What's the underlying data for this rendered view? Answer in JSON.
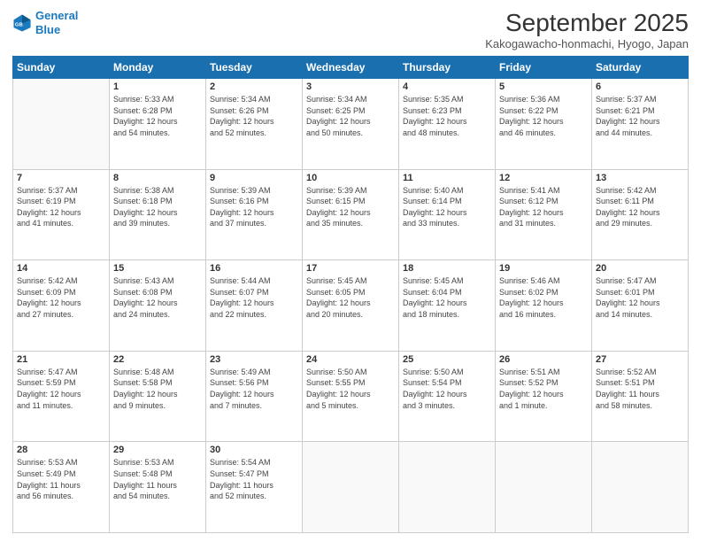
{
  "logo": {
    "line1": "General",
    "line2": "Blue"
  },
  "title": "September 2025",
  "location": "Kakogawacho-honmachi, Hyogo, Japan",
  "days_header": [
    "Sunday",
    "Monday",
    "Tuesday",
    "Wednesday",
    "Thursday",
    "Friday",
    "Saturday"
  ],
  "weeks": [
    [
      {
        "day": "",
        "info": ""
      },
      {
        "day": "1",
        "info": "Sunrise: 5:33 AM\nSunset: 6:28 PM\nDaylight: 12 hours\nand 54 minutes."
      },
      {
        "day": "2",
        "info": "Sunrise: 5:34 AM\nSunset: 6:26 PM\nDaylight: 12 hours\nand 52 minutes."
      },
      {
        "day": "3",
        "info": "Sunrise: 5:34 AM\nSunset: 6:25 PM\nDaylight: 12 hours\nand 50 minutes."
      },
      {
        "day": "4",
        "info": "Sunrise: 5:35 AM\nSunset: 6:23 PM\nDaylight: 12 hours\nand 48 minutes."
      },
      {
        "day": "5",
        "info": "Sunrise: 5:36 AM\nSunset: 6:22 PM\nDaylight: 12 hours\nand 46 minutes."
      },
      {
        "day": "6",
        "info": "Sunrise: 5:37 AM\nSunset: 6:21 PM\nDaylight: 12 hours\nand 44 minutes."
      }
    ],
    [
      {
        "day": "7",
        "info": "Sunrise: 5:37 AM\nSunset: 6:19 PM\nDaylight: 12 hours\nand 41 minutes."
      },
      {
        "day": "8",
        "info": "Sunrise: 5:38 AM\nSunset: 6:18 PM\nDaylight: 12 hours\nand 39 minutes."
      },
      {
        "day": "9",
        "info": "Sunrise: 5:39 AM\nSunset: 6:16 PM\nDaylight: 12 hours\nand 37 minutes."
      },
      {
        "day": "10",
        "info": "Sunrise: 5:39 AM\nSunset: 6:15 PM\nDaylight: 12 hours\nand 35 minutes."
      },
      {
        "day": "11",
        "info": "Sunrise: 5:40 AM\nSunset: 6:14 PM\nDaylight: 12 hours\nand 33 minutes."
      },
      {
        "day": "12",
        "info": "Sunrise: 5:41 AM\nSunset: 6:12 PM\nDaylight: 12 hours\nand 31 minutes."
      },
      {
        "day": "13",
        "info": "Sunrise: 5:42 AM\nSunset: 6:11 PM\nDaylight: 12 hours\nand 29 minutes."
      }
    ],
    [
      {
        "day": "14",
        "info": "Sunrise: 5:42 AM\nSunset: 6:09 PM\nDaylight: 12 hours\nand 27 minutes."
      },
      {
        "day": "15",
        "info": "Sunrise: 5:43 AM\nSunset: 6:08 PM\nDaylight: 12 hours\nand 24 minutes."
      },
      {
        "day": "16",
        "info": "Sunrise: 5:44 AM\nSunset: 6:07 PM\nDaylight: 12 hours\nand 22 minutes."
      },
      {
        "day": "17",
        "info": "Sunrise: 5:45 AM\nSunset: 6:05 PM\nDaylight: 12 hours\nand 20 minutes."
      },
      {
        "day": "18",
        "info": "Sunrise: 5:45 AM\nSunset: 6:04 PM\nDaylight: 12 hours\nand 18 minutes."
      },
      {
        "day": "19",
        "info": "Sunrise: 5:46 AM\nSunset: 6:02 PM\nDaylight: 12 hours\nand 16 minutes."
      },
      {
        "day": "20",
        "info": "Sunrise: 5:47 AM\nSunset: 6:01 PM\nDaylight: 12 hours\nand 14 minutes."
      }
    ],
    [
      {
        "day": "21",
        "info": "Sunrise: 5:47 AM\nSunset: 5:59 PM\nDaylight: 12 hours\nand 11 minutes."
      },
      {
        "day": "22",
        "info": "Sunrise: 5:48 AM\nSunset: 5:58 PM\nDaylight: 12 hours\nand 9 minutes."
      },
      {
        "day": "23",
        "info": "Sunrise: 5:49 AM\nSunset: 5:56 PM\nDaylight: 12 hours\nand 7 minutes."
      },
      {
        "day": "24",
        "info": "Sunrise: 5:50 AM\nSunset: 5:55 PM\nDaylight: 12 hours\nand 5 minutes."
      },
      {
        "day": "25",
        "info": "Sunrise: 5:50 AM\nSunset: 5:54 PM\nDaylight: 12 hours\nand 3 minutes."
      },
      {
        "day": "26",
        "info": "Sunrise: 5:51 AM\nSunset: 5:52 PM\nDaylight: 12 hours\nand 1 minute."
      },
      {
        "day": "27",
        "info": "Sunrise: 5:52 AM\nSunset: 5:51 PM\nDaylight: 11 hours\nand 58 minutes."
      }
    ],
    [
      {
        "day": "28",
        "info": "Sunrise: 5:53 AM\nSunset: 5:49 PM\nDaylight: 11 hours\nand 56 minutes."
      },
      {
        "day": "29",
        "info": "Sunrise: 5:53 AM\nSunset: 5:48 PM\nDaylight: 11 hours\nand 54 minutes."
      },
      {
        "day": "30",
        "info": "Sunrise: 5:54 AM\nSunset: 5:47 PM\nDaylight: 11 hours\nand 52 minutes."
      },
      {
        "day": "",
        "info": ""
      },
      {
        "day": "",
        "info": ""
      },
      {
        "day": "",
        "info": ""
      },
      {
        "day": "",
        "info": ""
      }
    ]
  ]
}
